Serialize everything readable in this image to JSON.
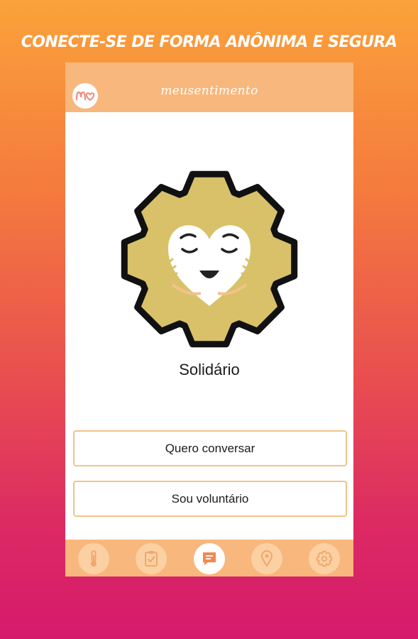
{
  "headline": "CONECTE-SE DE FORMA ANÔNIMA E SEGURA",
  "app": {
    "logo_text": "mo",
    "brand_name": "meusentimento"
  },
  "badge": {
    "title": "Solidário"
  },
  "actions": [
    {
      "label": "Quero conversar"
    },
    {
      "label": "Sou voluntário"
    }
  ],
  "tabbar": {
    "items": [
      {
        "icon": "thermometer-icon",
        "active": false
      },
      {
        "icon": "clipboard-check-icon",
        "active": false
      },
      {
        "icon": "chat-icon",
        "active": true
      },
      {
        "icon": "location-pin-icon",
        "active": false
      },
      {
        "icon": "gear-icon",
        "active": false
      }
    ]
  },
  "colors": {
    "header": "#f8b77c",
    "accent_gold": "#d9c16a",
    "button_border": "#f3c389",
    "gradient_top": "#fba23a",
    "gradient_bottom": "#d51a6c"
  }
}
